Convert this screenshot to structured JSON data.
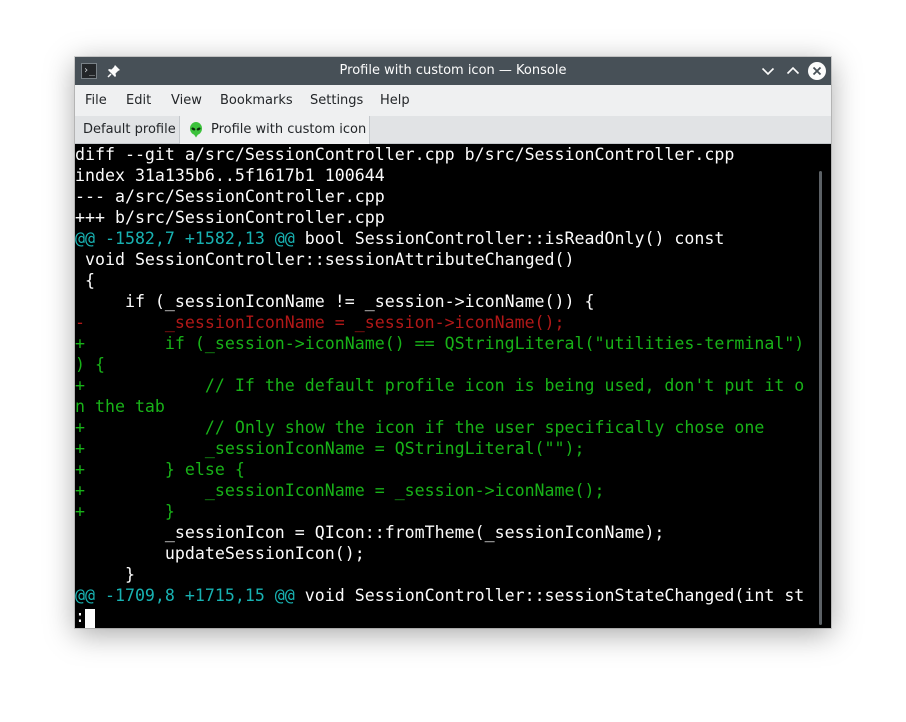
{
  "window": {
    "title": "Profile with custom icon — Konsole",
    "app_icon_glyph": "›_"
  },
  "menu": [
    "File",
    "Edit",
    "View",
    "Bookmarks",
    "Settings",
    "Help"
  ],
  "tabs": {
    "default_label": "Default profile",
    "active_label": "Profile with custom icon"
  },
  "terminal": {
    "lines": [
      {
        "text": "diff --git a/src/SessionController.cpp b/src/SessionController.cpp",
        "style": "white"
      },
      {
        "text": "index 31a135b6..5f1617b1 100644",
        "style": "white"
      },
      {
        "text": "--- a/src/SessionController.cpp",
        "style": "white"
      },
      {
        "text": "+++ b/src/SessionController.cpp",
        "style": "white"
      },
      {
        "text": "@@ -1582,7 +1582,13 @@",
        "style": "cyan",
        "rest": " bool SessionController::isReadOnly() const"
      },
      {
        "text": " void SessionController::sessionAttributeChanged()",
        "style": "white"
      },
      {
        "text": " {",
        "style": "white"
      },
      {
        "text": "     if (_sessionIconName != _session->iconName()) {",
        "style": "white"
      },
      {
        "text": "-        _sessionIconName = _session->iconName();",
        "style": "red"
      },
      {
        "text": "+        if (_session->iconName() == QStringLiteral(\"utilities-terminal\")",
        "style": "green"
      },
      {
        "text": ") {",
        "style": "green"
      },
      {
        "text": "+            // If the default profile icon is being used, don't put it o",
        "style": "green"
      },
      {
        "text": "n the tab",
        "style": "green"
      },
      {
        "text": "+            // Only show the icon if the user specifically chose one",
        "style": "green"
      },
      {
        "text": "+            _sessionIconName = QStringLiteral(\"\");",
        "style": "green"
      },
      {
        "text": "+        } else {",
        "style": "green"
      },
      {
        "text": "+            _sessionIconName = _session->iconName();",
        "style": "green"
      },
      {
        "text": "+        }",
        "style": "green"
      },
      {
        "text": "         _sessionIcon = QIcon::fromTheme(_sessionIconName);",
        "style": "white"
      },
      {
        "text": "         updateSessionIcon();",
        "style": "white"
      },
      {
        "text": "     }",
        "style": "white"
      },
      {
        "text": "@@ -1709,8 +1715,15 @@",
        "style": "cyan",
        "rest": " void SessionController::sessionStateChanged(int st"
      },
      {
        "text": ":",
        "style": "white"
      }
    ]
  },
  "colors": {
    "titlebar": "#475057",
    "menubar": "#eff0f1",
    "terminal_bg": "#000000",
    "fg": "#fcfcfc",
    "cyan": "#18b2b2",
    "red": "#b21818",
    "green": "#18b218"
  }
}
